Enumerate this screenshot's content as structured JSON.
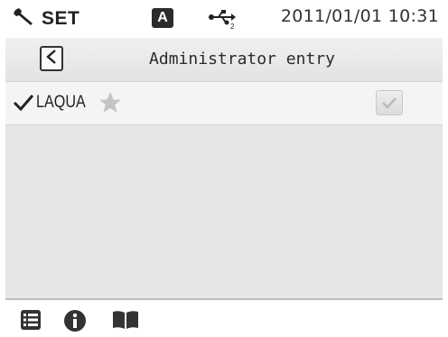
{
  "status_bar": {
    "mode_icon": "wrench-icon",
    "mode_label": "SET",
    "mode_badge": "A",
    "usb_icon": "usb-icon",
    "datetime": "2011/01/01 10:31"
  },
  "header": {
    "back_icon": "chevron-left-icon",
    "title": "Administrator entry"
  },
  "list": {
    "items": [
      {
        "label": "LAQUA",
        "selected": true,
        "favorite_icon": "star-icon",
        "checkbox_checked": true
      }
    ]
  },
  "toolbar": {
    "icons": [
      "list-icon",
      "info-icon",
      "book-icon"
    ]
  },
  "colors": {
    "content_bg": "#e6e6e6",
    "row_bg": "#f4f4f4",
    "star": "#c4c4c4",
    "disabled_check": "#b9b9b9"
  }
}
